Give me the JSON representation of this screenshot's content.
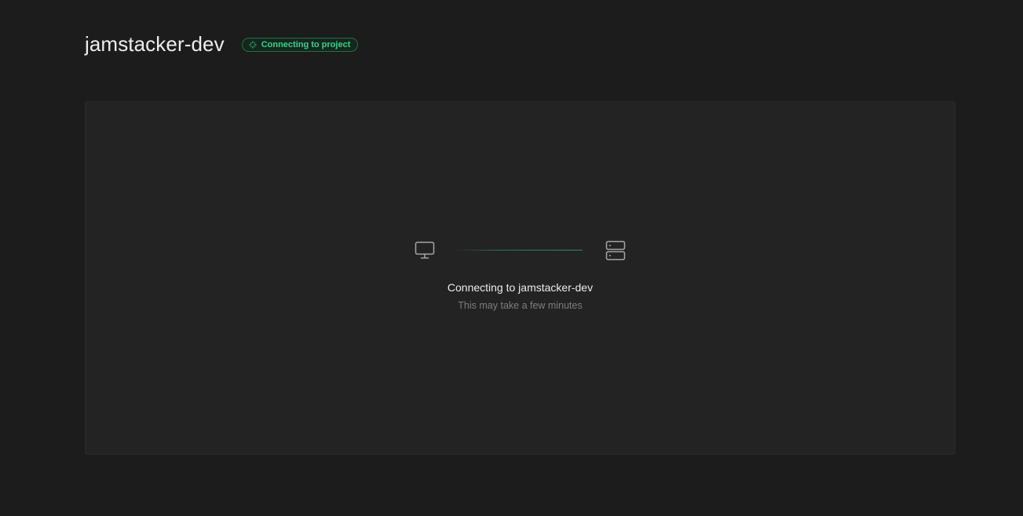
{
  "header": {
    "project_name": "jamstacker-dev",
    "status_badge": {
      "label": "Connecting to project",
      "icon": "loader-icon",
      "color": "#3ecf8e"
    }
  },
  "panel": {
    "client_icon": "monitor-icon",
    "server_icon": "server-icon",
    "title": "Connecting to jamstacker-dev",
    "subtitle": "This may take a few minutes"
  },
  "colors": {
    "background": "#1c1c1c",
    "panel": "#232323",
    "accent": "#3ecf8e"
  }
}
